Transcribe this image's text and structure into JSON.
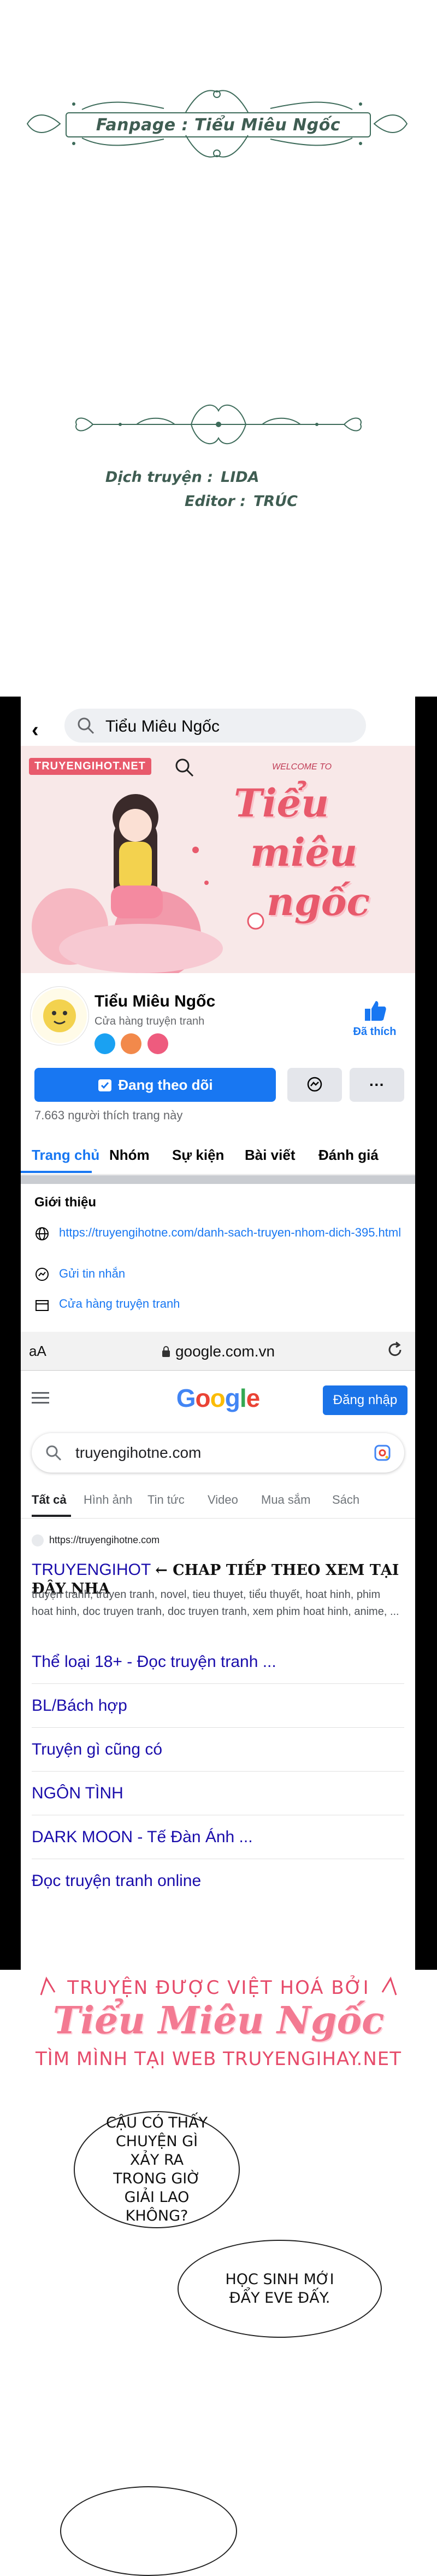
{
  "header": {
    "fanpage_label": "Fanpage : Tiểu Miêu Ngốc",
    "translator_label": "Dịch truyện :",
    "translator_value": "LIDA",
    "editor_label": "Editor :",
    "editor_value": "TRÚC"
  },
  "facebook": {
    "search_query": "Tiểu Miêu Ngốc",
    "cover_badge": "TRUYENGIHOT.NET",
    "cover_welcome": "WELCOME TO",
    "cover_title_lines": [
      "Tiểu",
      "miêu",
      "ngốc"
    ],
    "page_name": "Tiểu Miêu Ngốc",
    "page_category": "Cửa hàng truyện tranh",
    "like_label": "Đã thích",
    "follow_label": "Đang theo dõi",
    "more_label": "···",
    "likes_count": "7.663 người thích trang này",
    "tabs": [
      "Trang chủ",
      "Nhóm",
      "Sự kiện",
      "Bài viết",
      "Đánh giá"
    ],
    "intro_title": "Giới thiệu",
    "intro_link": "https://truyengihotne.com/danh-sach-truyen-nhom-dich-395.html",
    "intro_message": "Gửi tin nhắn",
    "intro_shop": "Cửa hàng truyện tranh",
    "accent": "#1877f2"
  },
  "browser": {
    "aa_label": "aA",
    "url": "google.com.vn"
  },
  "google": {
    "logo": [
      "G",
      "o",
      "o",
      "g",
      "l",
      "e"
    ],
    "logo_colors": [
      "#4285f4",
      "#ea4335",
      "#fbbc05",
      "#4285f4",
      "#34a853",
      "#ea4335"
    ],
    "signin_label": "Đăng nhập",
    "query": "truyengihotne.com",
    "tabs": [
      "Tất cả",
      "Hình ảnh",
      "Tin tức",
      "Video",
      "Mua sắm",
      "Sách"
    ],
    "result_site": "https://truyengihotne.com",
    "result_title": "TRUYENGIHOT",
    "result_promo": "← CHAP TIẾP THEO XEM TẠI ĐÂY NHA",
    "result_snippet": "truyện tranh, truyen tranh, novel, tieu thuyet, tiểu thuyết, hoat hinh, phim hoat hinh, doc truyen tranh, doc truyen tranh, xem phim hoat hinh, anime, ...",
    "sitelinks": [
      "Thể loại 18+ - Đọc truyện tranh ...",
      "BL/Bách hợp",
      "Truyện gì cũng có",
      "NGÔN TÌNH",
      "DARK MOON - Tế Đàn Ánh ...",
      "Đọc truyện tranh online"
    ]
  },
  "watermark": {
    "line1": "TRUYỆN ĐƯỢC VIỆT HOÁ BỞI",
    "line2": "Tiểu Miêu Ngốc",
    "line3": "TÌM MÌNH TẠI WEB TRUYENGIHAY.NET"
  },
  "comic": {
    "bubble1": "CẬU CÓ THẤY CHUYỆN GÌ XẢY RA TRONG GIỜ GIẢI LAO KHÔNG?",
    "bubble2": "HỌC SINH MỚI ĐẨY EVE ĐẤY."
  }
}
